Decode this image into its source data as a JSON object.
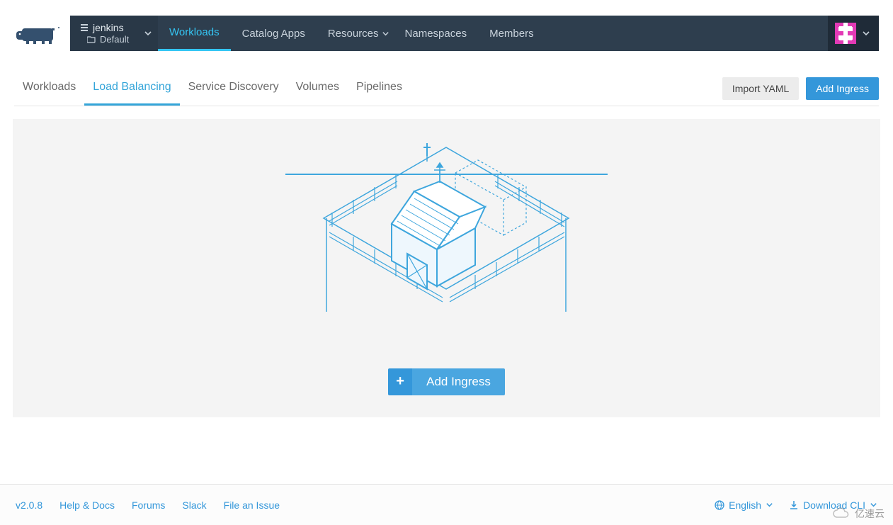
{
  "project": {
    "cluster": "jenkins",
    "namespace": "Default"
  },
  "topnav": {
    "workloads": "Workloads",
    "catalog": "Catalog Apps",
    "resources": "Resources",
    "namespaces": "Namespaces",
    "members": "Members"
  },
  "subtabs": {
    "workloads": "Workloads",
    "load_balancing": "Load Balancing",
    "service_discovery": "Service Discovery",
    "volumes": "Volumes",
    "pipelines": "Pipelines"
  },
  "actions": {
    "import_yaml": "Import YAML",
    "add_ingress": "Add Ingress"
  },
  "empty_state": {
    "add_ingress": "Add Ingress"
  },
  "footer": {
    "version": "v2.0.8",
    "help": "Help & Docs",
    "forums": "Forums",
    "slack": "Slack",
    "file_issue": "File an Issue",
    "language": "English",
    "download_cli": "Download CLI"
  },
  "watermark": "亿速云"
}
